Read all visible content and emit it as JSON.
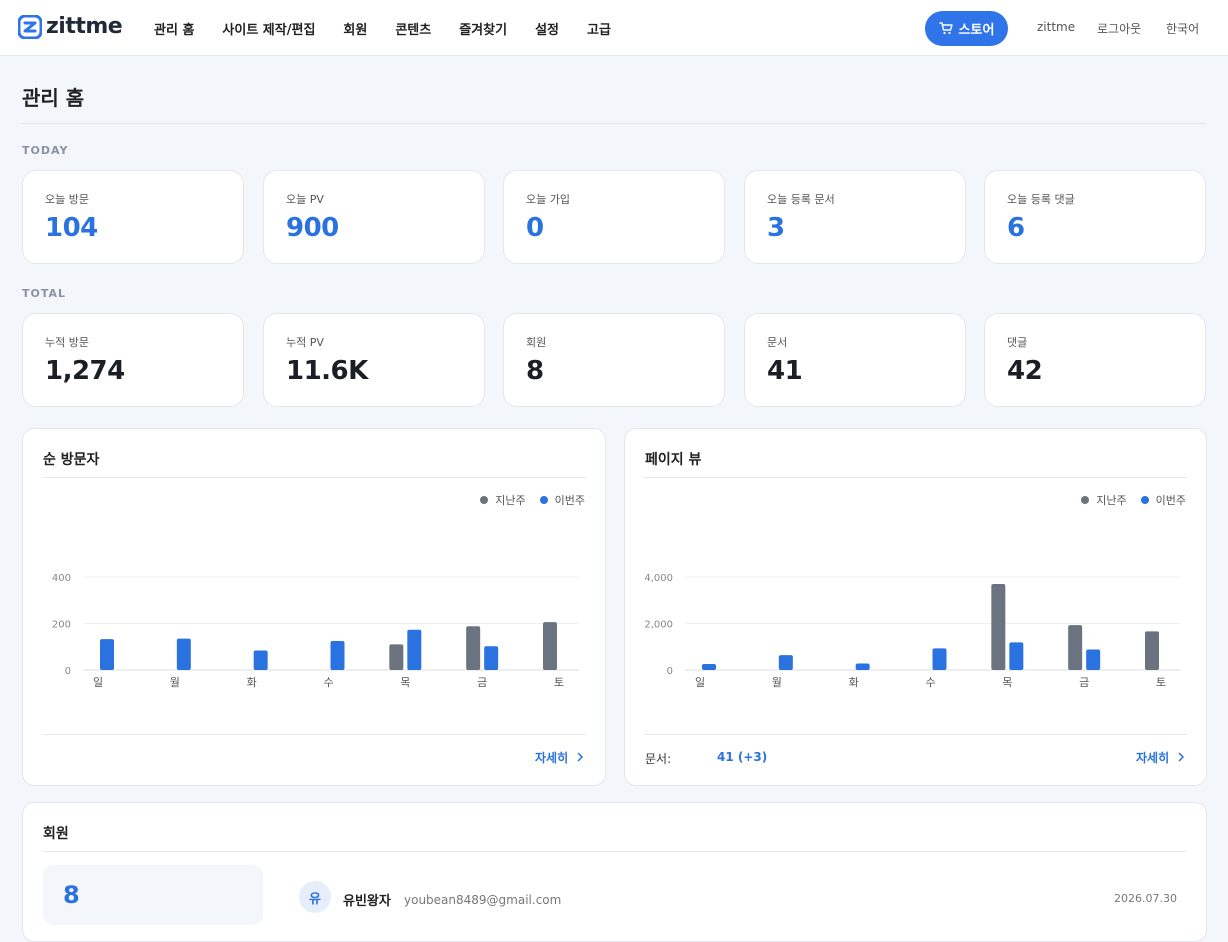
{
  "brand": {
    "name": "zittme"
  },
  "nav": [
    {
      "label": "관리 홈"
    },
    {
      "label": "사이트 제작/편집"
    },
    {
      "label": "회원"
    },
    {
      "label": "콘텐츠"
    },
    {
      "label": "즐겨찾기"
    },
    {
      "label": "설정"
    },
    {
      "label": "고급"
    }
  ],
  "topbar": {
    "store_label": "스토어",
    "user": "zittme",
    "logout": "로그아웃",
    "language": "한국어"
  },
  "page": {
    "title": "관리 홈"
  },
  "today": {
    "label": "TODAY",
    "cards": [
      {
        "label": "오늘 방문",
        "value": "104"
      },
      {
        "label": "오늘 PV",
        "value": "900"
      },
      {
        "label": "오늘 가입",
        "value": "0"
      },
      {
        "label": "오늘 등록 문서",
        "value": "3"
      },
      {
        "label": "오늘 등록 댓글",
        "value": "6"
      }
    ]
  },
  "total": {
    "label": "TOTAL",
    "cards": [
      {
        "label": "누적 방문",
        "value": "1,274"
      },
      {
        "label": "누적 PV",
        "value": "11.6K"
      },
      {
        "label": "회원",
        "value": "8"
      },
      {
        "label": "문서",
        "value": "41"
      },
      {
        "label": "댓글",
        "value": "42"
      }
    ]
  },
  "colors": {
    "accent": "#2f74e8",
    "last_week": "#6b7280",
    "this_week": "#2a72e0"
  },
  "chart_data": [
    {
      "type": "bar",
      "title": "순 방문자",
      "categories": [
        "일",
        "월",
        "화",
        "수",
        "목",
        "금",
        "토"
      ],
      "series": [
        {
          "name": "지난주",
          "values": [
            0,
            0,
            0,
            0,
            110,
            188,
            206
          ]
        },
        {
          "name": "이번주",
          "values": [
            133,
            135,
            84,
            125,
            173,
            102,
            0
          ]
        }
      ],
      "yticks": [
        "0",
        "200",
        "400"
      ],
      "ylim": [
        0,
        400
      ],
      "legend": "top-right",
      "grid": true
    },
    {
      "type": "bar",
      "title": "페이지 뷰",
      "categories": [
        "일",
        "월",
        "화",
        "수",
        "목",
        "금",
        "토"
      ],
      "series": [
        {
          "name": "지난주",
          "values": [
            0,
            0,
            0,
            0,
            3700,
            1930,
            1660
          ]
        },
        {
          "name": "이번주",
          "values": [
            260,
            640,
            280,
            930,
            1190,
            880,
            0
          ]
        }
      ],
      "yticks": [
        "0",
        "2,000",
        "4,000"
      ],
      "ylim": [
        0,
        4000
      ],
      "legend": "top-right",
      "grid": true
    }
  ],
  "visitors_panel": {
    "more": "자세히"
  },
  "pageview_panel": {
    "more": "자세히",
    "doc_label": "문서:",
    "doc_value": "41 (+3)"
  },
  "members_panel": {
    "title": "회원",
    "count": "8",
    "latest": {
      "avatar": "유",
      "name": "유빈왕자",
      "email": "youbean8489@gmail.com",
      "date": "2026.07.30"
    }
  }
}
